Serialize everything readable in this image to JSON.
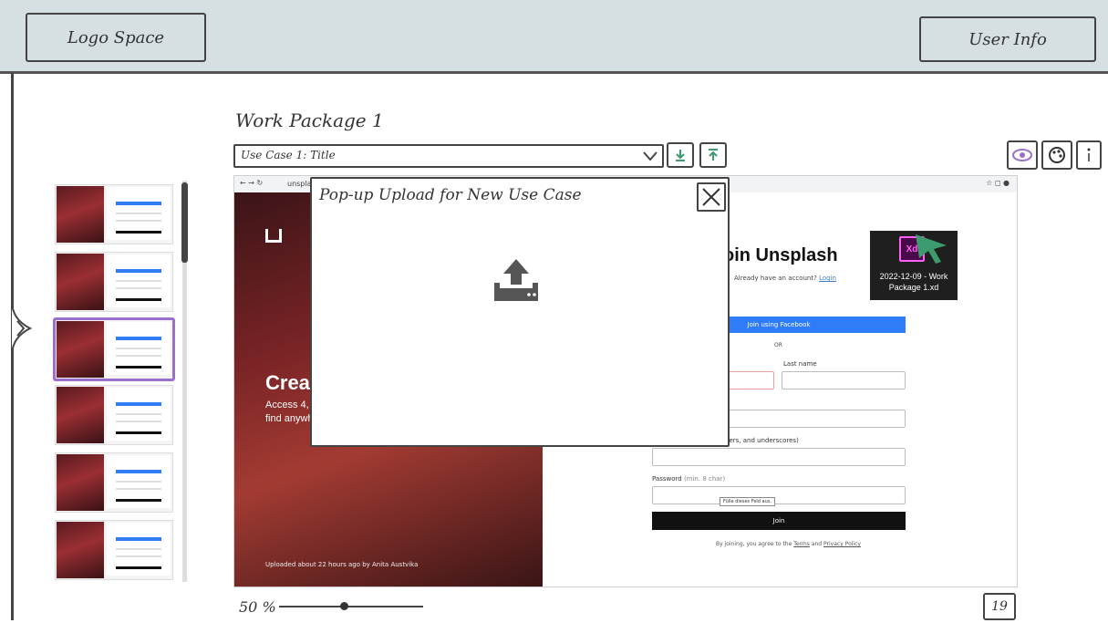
{
  "header": {
    "logo_text": "Logo Space",
    "user_text": "User Info"
  },
  "work_package": {
    "title": "Work Package 1",
    "use_case_selected": "Use Case 1: Title"
  },
  "preview": {
    "browser_url": "unsplas",
    "hero": {
      "heading": "Crea",
      "line1": "Access 4,",
      "line2": "find anywh",
      "uploaded": "Uploaded about 22 hours ago by Anita Austvika"
    },
    "form": {
      "heading": "oin Unsplash",
      "already": "Already have an account?",
      "login": "Login",
      "facebook": "Join using Facebook",
      "or": "OR",
      "last_name": "Last name",
      "username_hint": "bers, and underscores)",
      "password_label": "Password",
      "password_hint": "(min. 8 char)",
      "tooltip": "Fülle dieses Feld aus.",
      "join": "Join",
      "agree_prefix": "By joining, you agree to the",
      "terms": "Terms",
      "and": "and",
      "privacy": "Privacy Policy"
    },
    "xd_file": {
      "icon_text": "Xd",
      "name": "2022-12-09 - Work Package 1.xd"
    }
  },
  "popup": {
    "title": "Pop-up Upload for New Use Case"
  },
  "footer": {
    "zoom": "50 %",
    "zoom_fraction": 0.45,
    "page_number": "19"
  },
  "colors": {
    "header_bg": "#d6dfe2",
    "selected_thumb": "#9b6fcd",
    "eye_icon": "#9b6fcd",
    "palette_icon": "#3c9b6f",
    "download_icon": "#3c9b6f",
    "facebook_blue": "#2f7cf6"
  }
}
